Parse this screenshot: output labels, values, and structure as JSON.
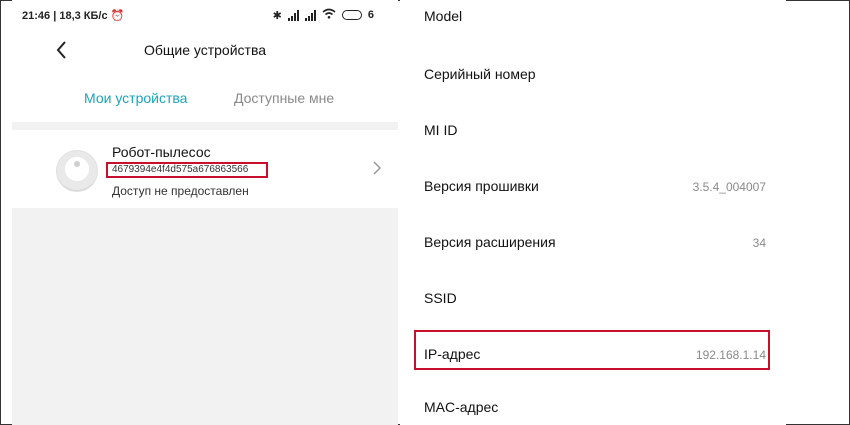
{
  "status_bar": {
    "time": "21:46",
    "speed": "18,3 КБ/с",
    "battery": "6"
  },
  "header": {
    "title": "Общие устройства"
  },
  "tabs": [
    {
      "label": "Мои устройства",
      "active": true
    },
    {
      "label": "Доступные мне",
      "active": false
    }
  ],
  "device": {
    "name": "Робот-пылесос",
    "id": "4679394e4f4d575a676863566",
    "status": "Доступ не предоставлен"
  },
  "settings": [
    {
      "label": "Model",
      "value": ""
    },
    {
      "label": "Серийный номер",
      "value": ""
    },
    {
      "label": "MI ID",
      "value": ""
    },
    {
      "label": "Версия прошивки",
      "value": "3.5.4_004007"
    },
    {
      "label": "Версия расширения",
      "value": "34"
    },
    {
      "label": "SSID",
      "value": ""
    },
    {
      "label": "IP-адрес",
      "value": "192.168.1.14"
    },
    {
      "label": "MAC-адрес",
      "value": ""
    }
  ],
  "colors": {
    "accent": "#1aa6b7",
    "highlight": "#c8102e",
    "muted": "#8a8a8a"
  }
}
